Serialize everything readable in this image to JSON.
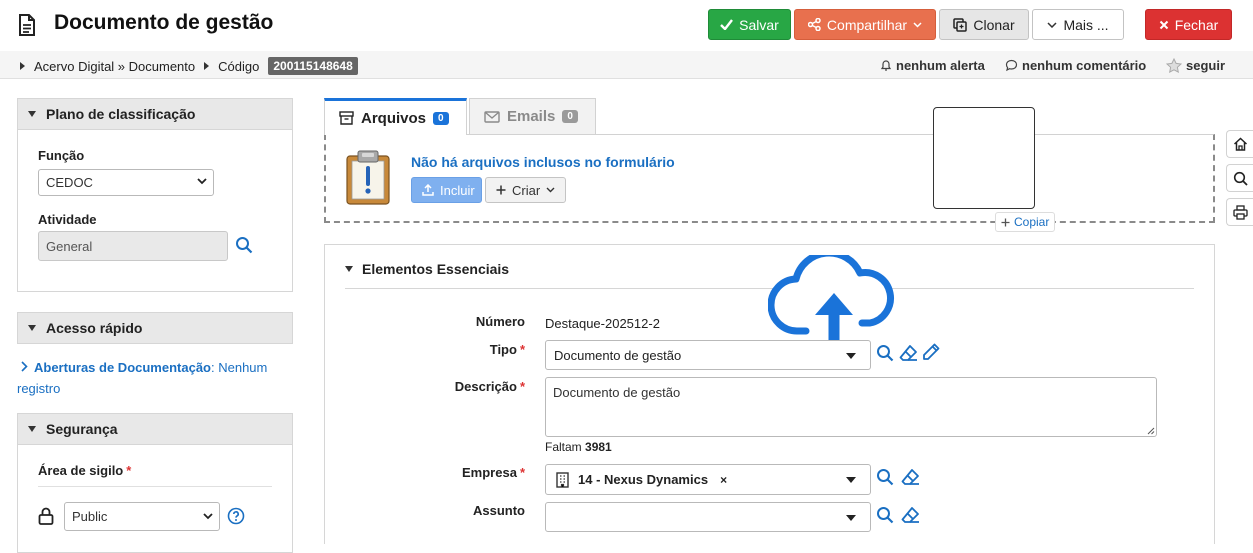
{
  "header": {
    "title": "Documento de gestão",
    "actions": {
      "save": "Salvar",
      "share": "Compartilhar",
      "clone": "Clonar",
      "more": "Mais ...",
      "close": "Fechar"
    }
  },
  "breadcrumb": {
    "path": "Acervo Digital » Documento",
    "code_label": "Código",
    "code_value": "200115148648"
  },
  "meta": {
    "alerts": "nenhum alerta",
    "comments": "nenhum comentário",
    "follow": "seguir"
  },
  "sidebar": {
    "classification": {
      "title": "Plano de classificação",
      "function_label": "Função",
      "function_value": "CEDOC",
      "activity_label": "Atividade",
      "activity_value": "General"
    },
    "quick_access": {
      "title": "Acesso rápido",
      "link_label": "Aberturas de Documentação",
      "link_value": ": Nenhum registro"
    },
    "security": {
      "title": "Segurança",
      "area_label": "Área de sigilo",
      "area_value": "Public"
    }
  },
  "files": {
    "tabs": [
      {
        "label": "Arquivos",
        "count": "0"
      },
      {
        "label": "Emails",
        "count": "0"
      }
    ],
    "empty_message": "Não há arquivos inclusos no formulário",
    "include_label": "Incluir",
    "create_label": "Criar",
    "copy_label": "Copiar"
  },
  "essentials": {
    "title": "Elementos Essenciais",
    "numero_label": "Número",
    "numero_value": "Destaque-202512-2",
    "tipo_label": "Tipo",
    "tipo_value": "Documento de gestão",
    "descricao_label": "Descrição",
    "descricao_value": "Documento de gestão",
    "remaining_label": "Faltam",
    "remaining_value": "3981",
    "empresa_label": "Empresa",
    "empresa_value": "14 - Nexus Dynamics",
    "assunto_label": "Assunto",
    "assunto_value": ""
  },
  "colors": {
    "save": "#28a745",
    "share": "#e8704e",
    "close": "#dc3232",
    "link": "#1a6fc2",
    "accent": "#1a73d9"
  }
}
